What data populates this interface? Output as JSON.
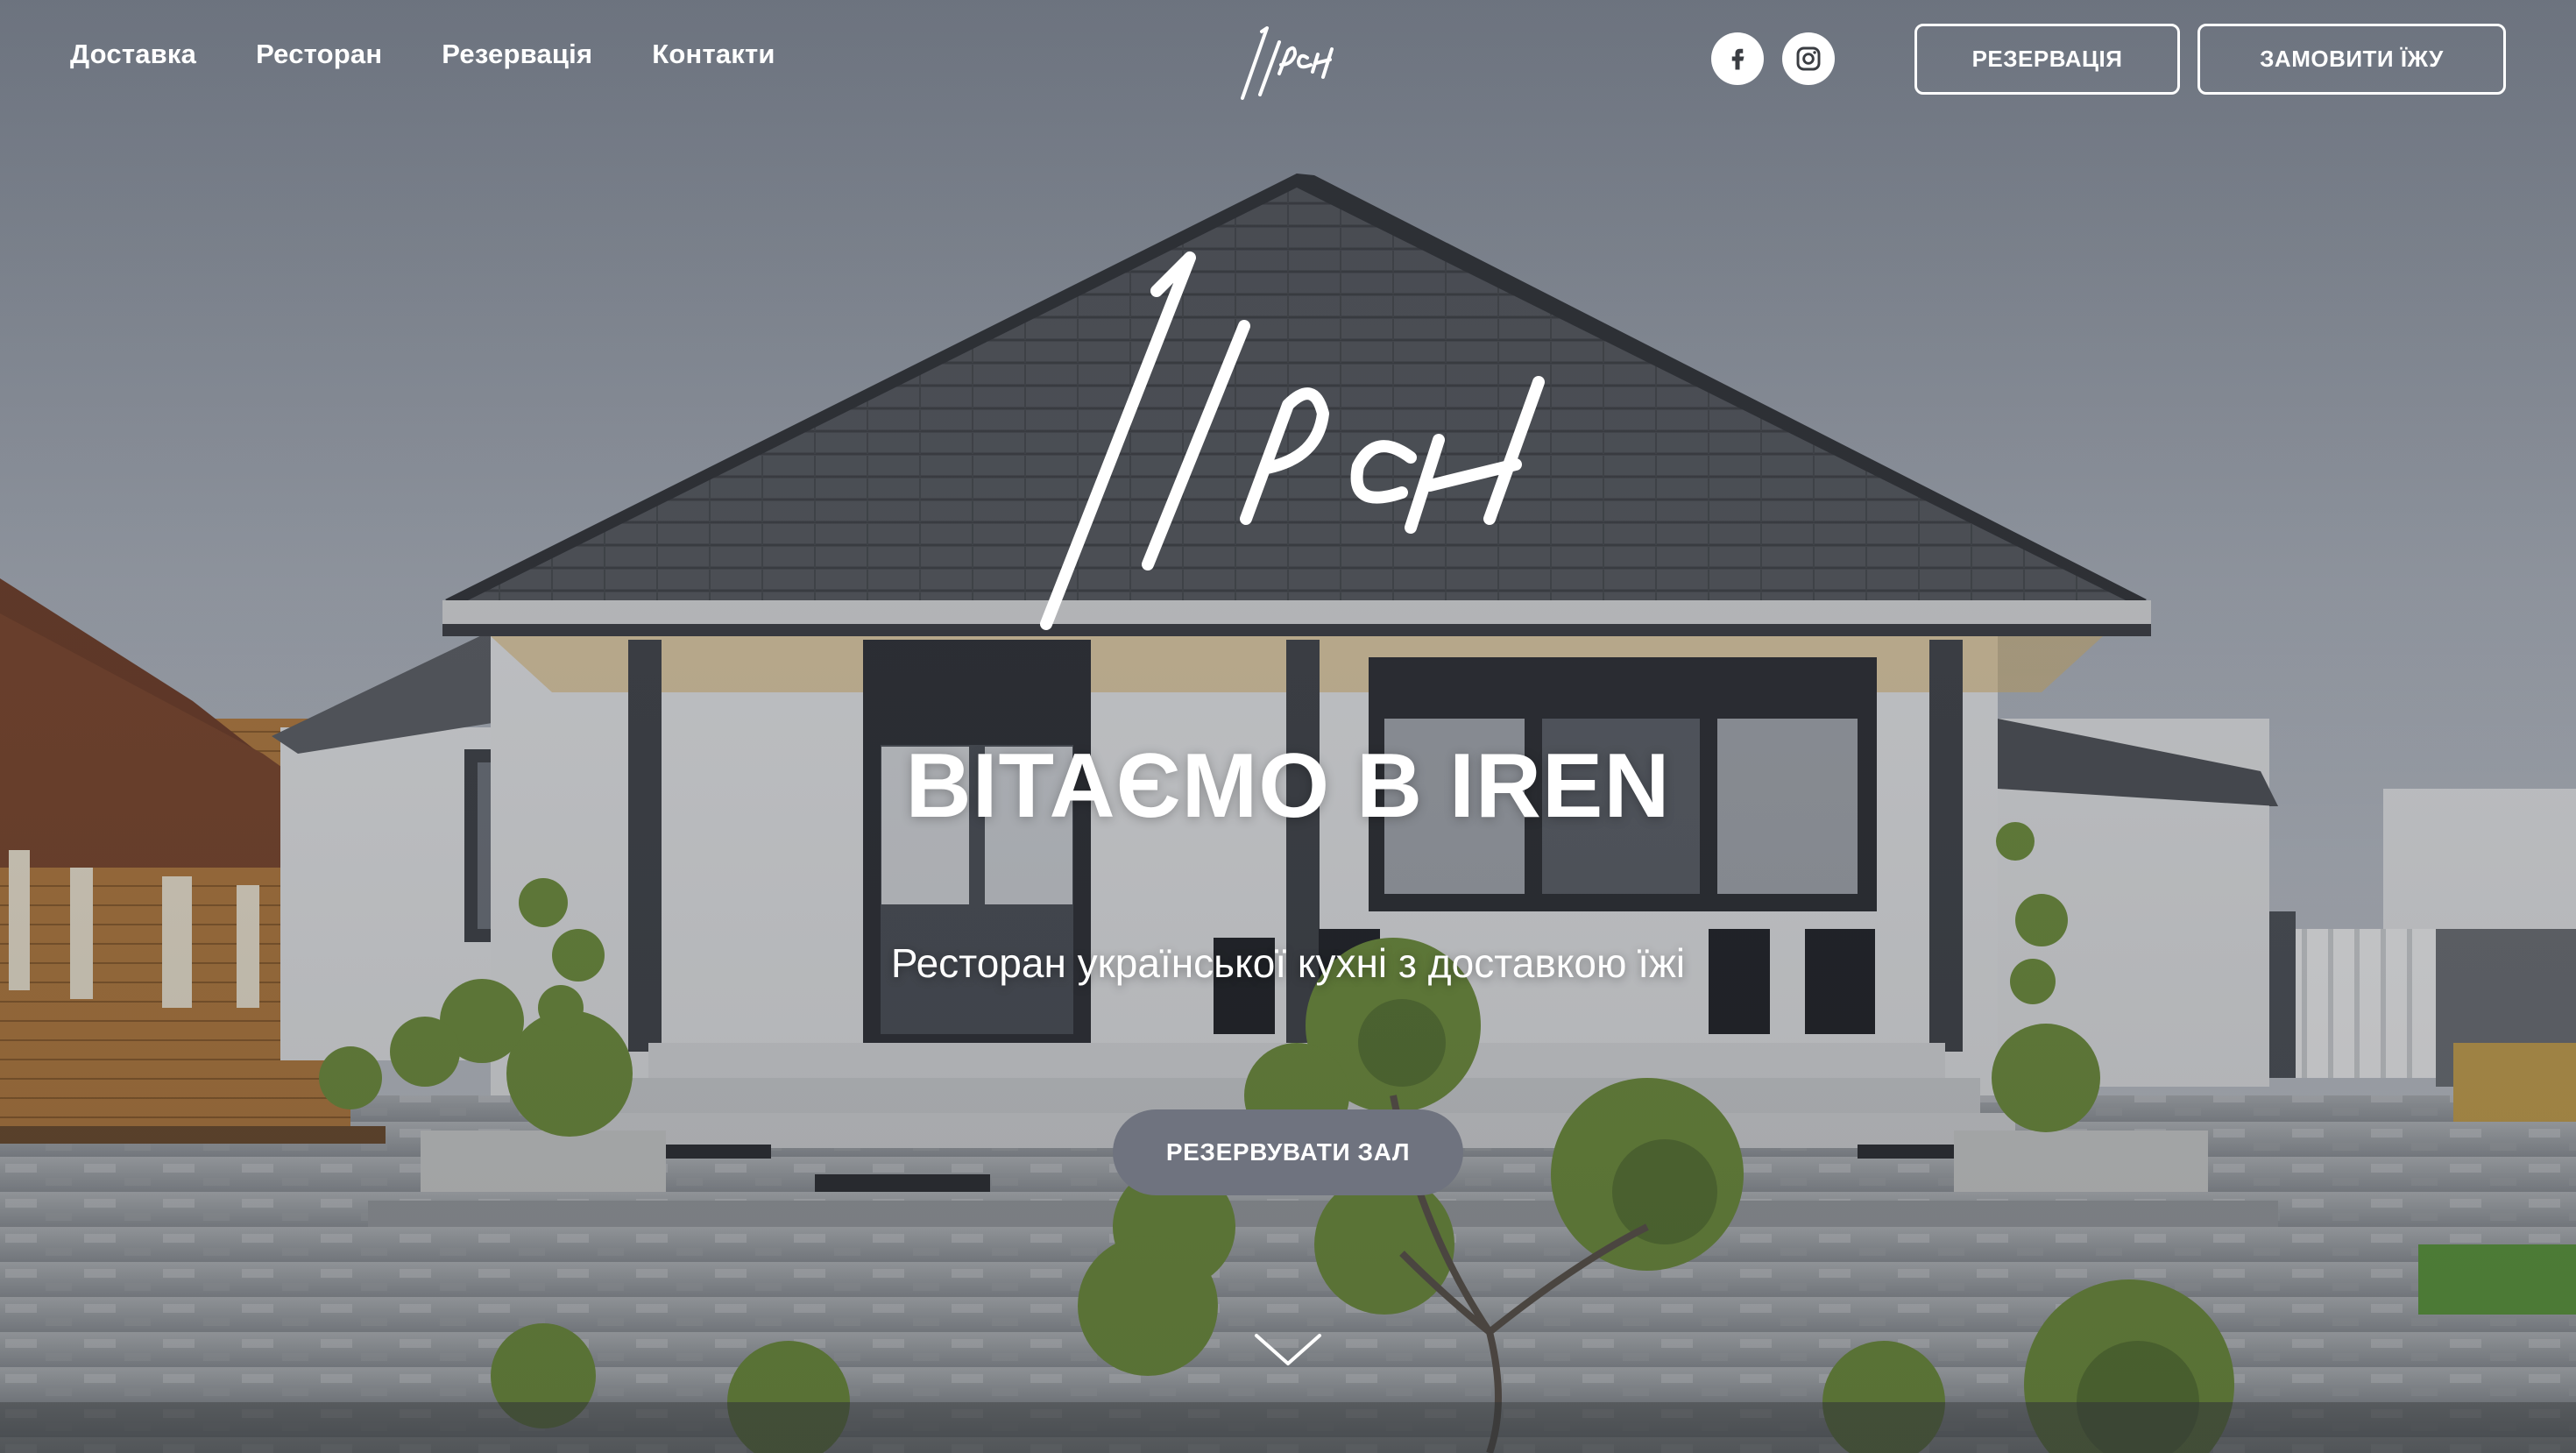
{
  "header": {
    "nav": [
      {
        "label": "Доставка"
      },
      {
        "label": "Ресторан"
      },
      {
        "label": "Резервація"
      },
      {
        "label": "Контакти"
      }
    ],
    "logo_text": "Ірен",
    "socials": [
      {
        "icon": "facebook-icon"
      },
      {
        "icon": "instagram-icon"
      }
    ],
    "reserve_button": "РЕЗЕРВАЦІЯ",
    "order_button": "ЗАМОВИТИ ЇЖУ"
  },
  "hero": {
    "logo_text": "Ірен",
    "title": "ВІТАЄМО В IREN",
    "subtitle": "Ресторан української кухні з доставкою їжі",
    "cta": "РЕЗЕРВУВАТИ ЗАЛ",
    "scroll_icon": "chevron-down-icon"
  },
  "colors": {
    "text": "#ffffff",
    "cta_bg": "#6f737f",
    "roof": "#4a4d52",
    "wall": "#e9e9ea",
    "wood": "#b47a3c",
    "greenery": "#6f8f3a"
  }
}
